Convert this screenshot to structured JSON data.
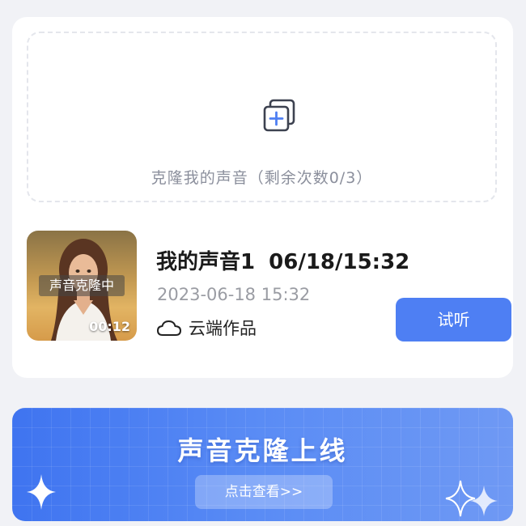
{
  "upload": {
    "icon": "add-copy-icon",
    "text": "克隆我的声音（剩余次数0/3）"
  },
  "voice": {
    "thumbnail_badge": "声音克隆中",
    "duration": "00:12",
    "title": "我的声音1 06/18/15:32",
    "date": "2023-06-18 15:32",
    "tag_icon": "cloud-icon",
    "tag_label": "云端作品",
    "listen_label": "试听"
  },
  "banner": {
    "title": "声音克隆上线",
    "button_label": "点击查看>>"
  },
  "colors": {
    "accent": "#4e7ff3",
    "page_background": "#f1f2f6",
    "card_background": "#ffffff",
    "muted_text": "#9a9ca3"
  }
}
